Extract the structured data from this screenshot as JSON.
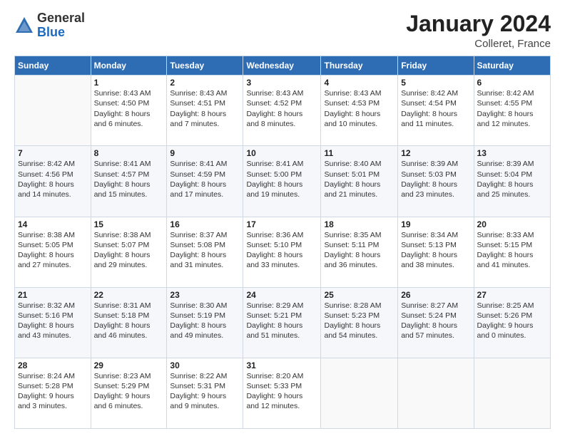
{
  "logo": {
    "general": "General",
    "blue": "Blue"
  },
  "header": {
    "title": "January 2024",
    "subtitle": "Colleret, France"
  },
  "weekdays": [
    "Sunday",
    "Monday",
    "Tuesday",
    "Wednesday",
    "Thursday",
    "Friday",
    "Saturday"
  ],
  "weeks": [
    [
      {
        "day": "",
        "info": ""
      },
      {
        "day": "1",
        "info": "Sunrise: 8:43 AM\nSunset: 4:50 PM\nDaylight: 8 hours\nand 6 minutes."
      },
      {
        "day": "2",
        "info": "Sunrise: 8:43 AM\nSunset: 4:51 PM\nDaylight: 8 hours\nand 7 minutes."
      },
      {
        "day": "3",
        "info": "Sunrise: 8:43 AM\nSunset: 4:52 PM\nDaylight: 8 hours\nand 8 minutes."
      },
      {
        "day": "4",
        "info": "Sunrise: 8:43 AM\nSunset: 4:53 PM\nDaylight: 8 hours\nand 10 minutes."
      },
      {
        "day": "5",
        "info": "Sunrise: 8:42 AM\nSunset: 4:54 PM\nDaylight: 8 hours\nand 11 minutes."
      },
      {
        "day": "6",
        "info": "Sunrise: 8:42 AM\nSunset: 4:55 PM\nDaylight: 8 hours\nand 12 minutes."
      }
    ],
    [
      {
        "day": "7",
        "info": "Sunrise: 8:42 AM\nSunset: 4:56 PM\nDaylight: 8 hours\nand 14 minutes."
      },
      {
        "day": "8",
        "info": "Sunrise: 8:41 AM\nSunset: 4:57 PM\nDaylight: 8 hours\nand 15 minutes."
      },
      {
        "day": "9",
        "info": "Sunrise: 8:41 AM\nSunset: 4:59 PM\nDaylight: 8 hours\nand 17 minutes."
      },
      {
        "day": "10",
        "info": "Sunrise: 8:41 AM\nSunset: 5:00 PM\nDaylight: 8 hours\nand 19 minutes."
      },
      {
        "day": "11",
        "info": "Sunrise: 8:40 AM\nSunset: 5:01 PM\nDaylight: 8 hours\nand 21 minutes."
      },
      {
        "day": "12",
        "info": "Sunrise: 8:39 AM\nSunset: 5:03 PM\nDaylight: 8 hours\nand 23 minutes."
      },
      {
        "day": "13",
        "info": "Sunrise: 8:39 AM\nSunset: 5:04 PM\nDaylight: 8 hours\nand 25 minutes."
      }
    ],
    [
      {
        "day": "14",
        "info": "Sunrise: 8:38 AM\nSunset: 5:05 PM\nDaylight: 8 hours\nand 27 minutes."
      },
      {
        "day": "15",
        "info": "Sunrise: 8:38 AM\nSunset: 5:07 PM\nDaylight: 8 hours\nand 29 minutes."
      },
      {
        "day": "16",
        "info": "Sunrise: 8:37 AM\nSunset: 5:08 PM\nDaylight: 8 hours\nand 31 minutes."
      },
      {
        "day": "17",
        "info": "Sunrise: 8:36 AM\nSunset: 5:10 PM\nDaylight: 8 hours\nand 33 minutes."
      },
      {
        "day": "18",
        "info": "Sunrise: 8:35 AM\nSunset: 5:11 PM\nDaylight: 8 hours\nand 36 minutes."
      },
      {
        "day": "19",
        "info": "Sunrise: 8:34 AM\nSunset: 5:13 PM\nDaylight: 8 hours\nand 38 minutes."
      },
      {
        "day": "20",
        "info": "Sunrise: 8:33 AM\nSunset: 5:15 PM\nDaylight: 8 hours\nand 41 minutes."
      }
    ],
    [
      {
        "day": "21",
        "info": "Sunrise: 8:32 AM\nSunset: 5:16 PM\nDaylight: 8 hours\nand 43 minutes."
      },
      {
        "day": "22",
        "info": "Sunrise: 8:31 AM\nSunset: 5:18 PM\nDaylight: 8 hours\nand 46 minutes."
      },
      {
        "day": "23",
        "info": "Sunrise: 8:30 AM\nSunset: 5:19 PM\nDaylight: 8 hours\nand 49 minutes."
      },
      {
        "day": "24",
        "info": "Sunrise: 8:29 AM\nSunset: 5:21 PM\nDaylight: 8 hours\nand 51 minutes."
      },
      {
        "day": "25",
        "info": "Sunrise: 8:28 AM\nSunset: 5:23 PM\nDaylight: 8 hours\nand 54 minutes."
      },
      {
        "day": "26",
        "info": "Sunrise: 8:27 AM\nSunset: 5:24 PM\nDaylight: 8 hours\nand 57 minutes."
      },
      {
        "day": "27",
        "info": "Sunrise: 8:25 AM\nSunset: 5:26 PM\nDaylight: 9 hours\nand 0 minutes."
      }
    ],
    [
      {
        "day": "28",
        "info": "Sunrise: 8:24 AM\nSunset: 5:28 PM\nDaylight: 9 hours\nand 3 minutes."
      },
      {
        "day": "29",
        "info": "Sunrise: 8:23 AM\nSunset: 5:29 PM\nDaylight: 9 hours\nand 6 minutes."
      },
      {
        "day": "30",
        "info": "Sunrise: 8:22 AM\nSunset: 5:31 PM\nDaylight: 9 hours\nand 9 minutes."
      },
      {
        "day": "31",
        "info": "Sunrise: 8:20 AM\nSunset: 5:33 PM\nDaylight: 9 hours\nand 12 minutes."
      },
      {
        "day": "",
        "info": ""
      },
      {
        "day": "",
        "info": ""
      },
      {
        "day": "",
        "info": ""
      }
    ]
  ]
}
